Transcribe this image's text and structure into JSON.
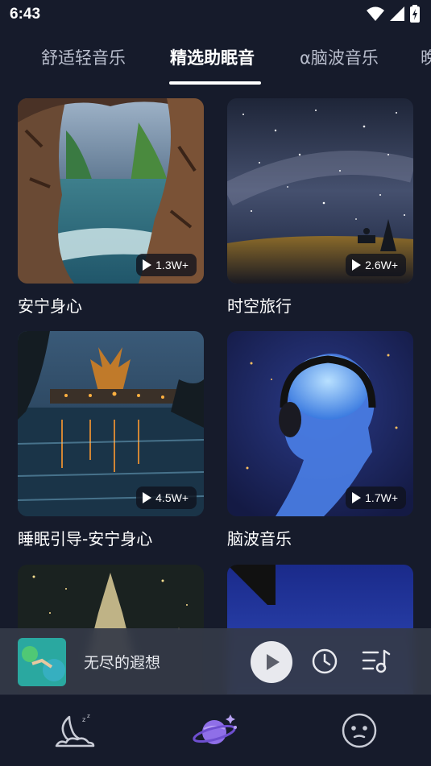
{
  "status_bar": {
    "time": "6:43"
  },
  "tabs": [
    {
      "label": "舒适轻音乐",
      "active": false
    },
    {
      "label": "精选助眠音",
      "active": true
    },
    {
      "label": "α脑波音乐",
      "active": false
    },
    {
      "label": "晚",
      "active": false
    }
  ],
  "cards": [
    {
      "title": "安宁身心",
      "plays": "1.3W+"
    },
    {
      "title": "时空旅行",
      "plays": "2.6W+"
    },
    {
      "title": "睡眠引导-安宁身心",
      "plays": "4.5W+"
    },
    {
      "title": "脑波音乐",
      "plays": "1.7W+"
    }
  ],
  "mini_player": {
    "title": "无尽的遐想"
  },
  "bottom_nav": [
    {
      "icon": "moon-sleep-icon",
      "active": false
    },
    {
      "icon": "planet-icon",
      "active": true
    },
    {
      "icon": "face-icon",
      "active": false
    }
  ],
  "colors": {
    "background": "#161b2b",
    "active_nav": "#8f6fe8"
  }
}
